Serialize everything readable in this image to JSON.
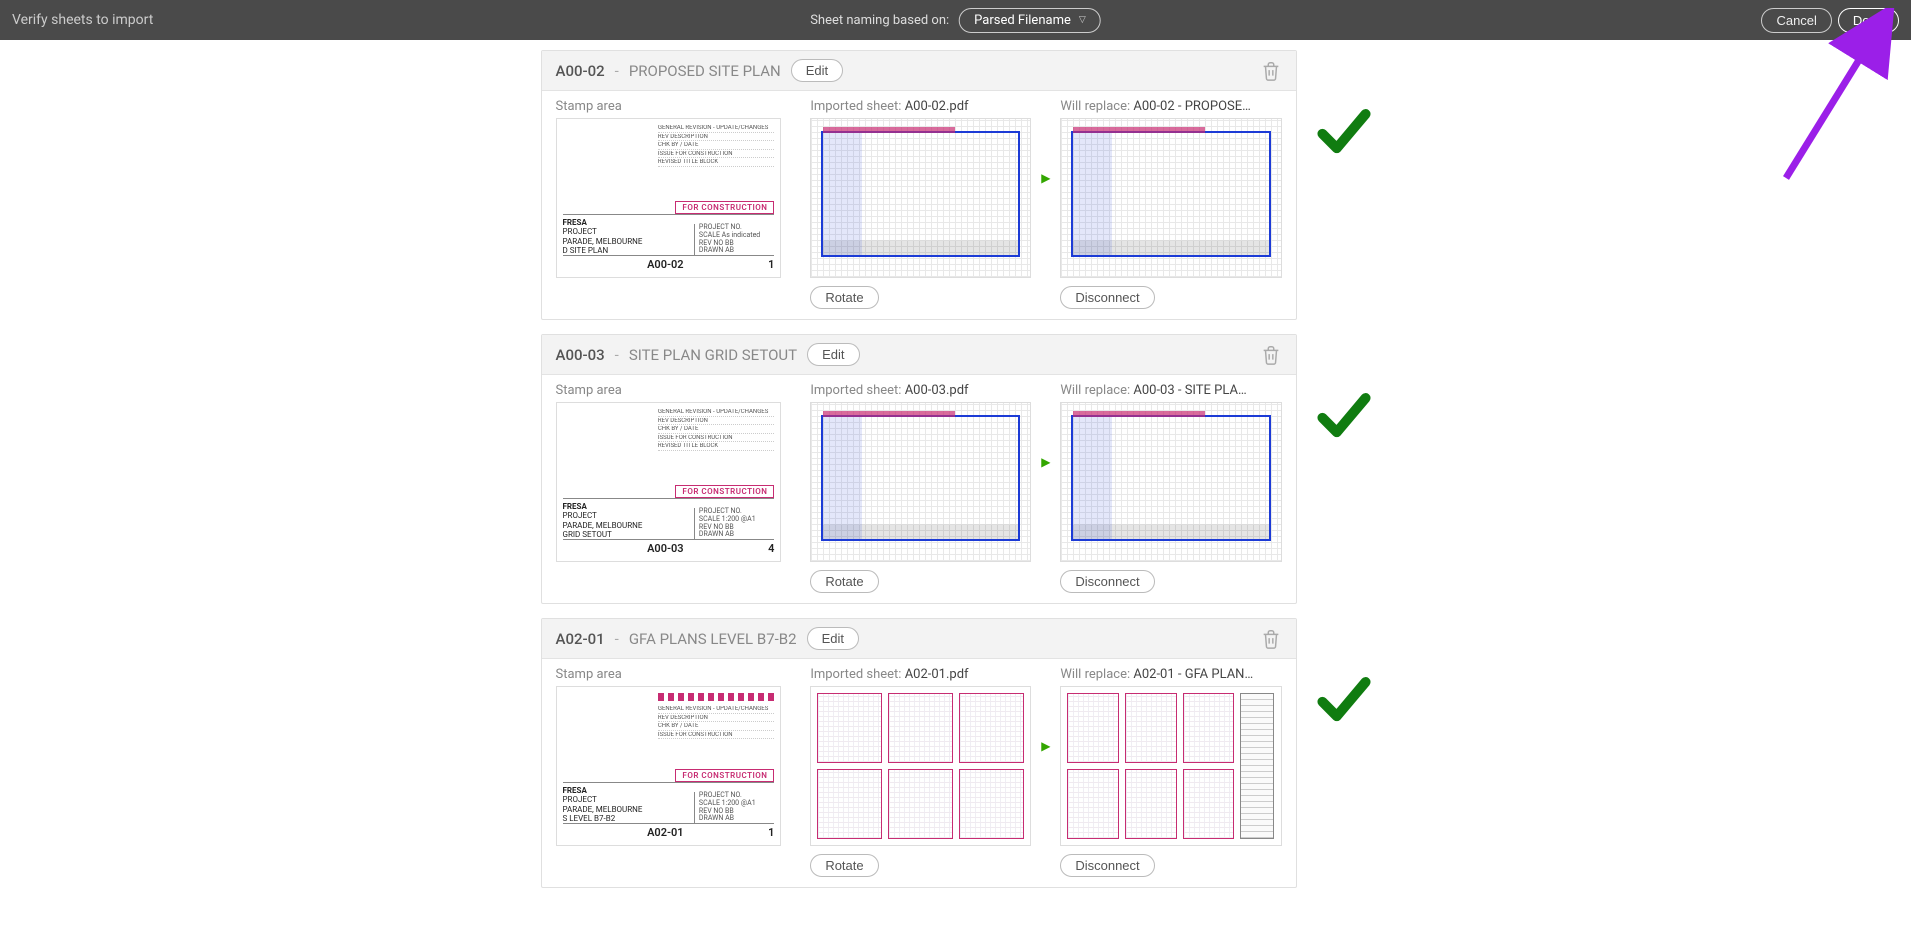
{
  "topbar": {
    "title": "Verify sheets to import",
    "naming_label": "Sheet naming based on:",
    "naming_value": "Parsed Filename",
    "cancel": "Cancel",
    "done": "Done"
  },
  "labels": {
    "stamp_area": "Stamp area",
    "imported_sheet": "Imported sheet:",
    "will_replace": "Will replace:",
    "rotate": "Rotate",
    "disconnect": "Disconnect",
    "edit": "Edit"
  },
  "stamp_common": {
    "project1": "FRESA",
    "project2": "PROJECT",
    "project3": "PARADE, MELBOURNE",
    "for_construction": "FOR CONSTRUCTION",
    "rev": "1"
  },
  "sheets": [
    {
      "id": "A00-02",
      "title": "PROPOSED SITE PLAN",
      "imported": "A00-02.pdf",
      "replace": "A00-02 - PROPOSE…",
      "stamp_line": "D SITE PLAN"
    },
    {
      "id": "A00-03",
      "title": "SITE PLAN GRID SETOUT",
      "imported": "A00-03.pdf",
      "replace": "A00-03 - SITE PLA…",
      "stamp_line": "GRID SETOUT"
    },
    {
      "id": "A02-01",
      "title": "GFA PLANS LEVEL B7-B2",
      "imported": "A02-01.pdf",
      "replace": "A02-01 - GFA PLAN…",
      "stamp_line": "S LEVEL B7-B2"
    }
  ]
}
